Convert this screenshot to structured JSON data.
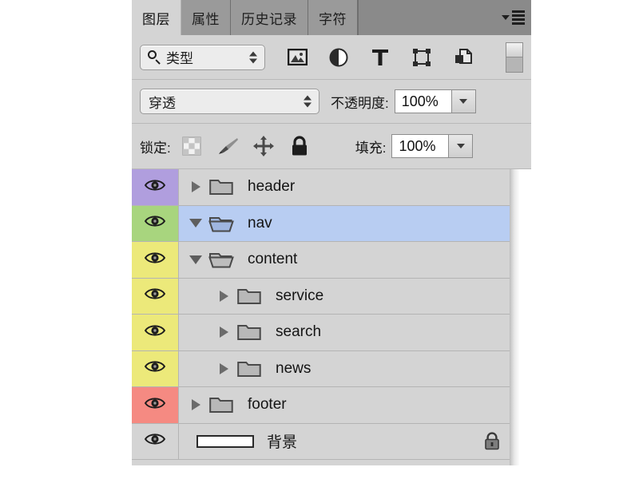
{
  "panel": {
    "tabs": [
      {
        "label": "图层",
        "active": true
      },
      {
        "label": "属性",
        "active": false
      },
      {
        "label": "历史记录",
        "active": false
      },
      {
        "label": "字符",
        "active": false
      }
    ],
    "menu_icon": "panel-menu-icon"
  },
  "filter_row": {
    "search_icon": "search-icon",
    "filter_type": "类型",
    "icons": [
      {
        "name": "filter-pixel-layers-icon"
      },
      {
        "name": "filter-adjustment-layers-icon"
      },
      {
        "name": "filter-type-layers-icon"
      },
      {
        "name": "filter-shape-layers-icon"
      },
      {
        "name": "filter-smart-object-icon"
      }
    ],
    "toggle": "filter-enable-toggle"
  },
  "blend_row": {
    "blend_mode": "穿透",
    "opacity_label": "不透明度:",
    "opacity_value": "100%"
  },
  "lock_row": {
    "lock_label": "锁定:",
    "lock_icons": [
      {
        "name": "lock-transparent-pixels-icon"
      },
      {
        "name": "lock-image-pixels-icon"
      },
      {
        "name": "lock-position-icon"
      },
      {
        "name": "lock-all-icon"
      }
    ],
    "fill_label": "填充:",
    "fill_value": "100%"
  },
  "layers": [
    {
      "name": "header",
      "type": "group",
      "expanded": false,
      "indent": 0,
      "color": "#b09ede",
      "eye": "visible",
      "selected": false,
      "locked": false
    },
    {
      "name": "nav",
      "type": "group",
      "expanded": true,
      "indent": 0,
      "color": "#a8d57e",
      "eye": "visible",
      "selected": true,
      "locked": false
    },
    {
      "name": "content",
      "type": "group",
      "expanded": true,
      "indent": 0,
      "color": "#ece97a",
      "eye": "visible",
      "selected": false,
      "locked": false
    },
    {
      "name": "service",
      "type": "group",
      "expanded": false,
      "indent": 1,
      "color": "#ece97a",
      "eye": "visible",
      "selected": false,
      "locked": false
    },
    {
      "name": "search",
      "type": "group",
      "expanded": false,
      "indent": 1,
      "color": "#ece97a",
      "eye": "visible",
      "selected": false,
      "locked": false
    },
    {
      "name": "news",
      "type": "group",
      "expanded": false,
      "indent": 1,
      "color": "#ece97a",
      "eye": "visible",
      "selected": false,
      "locked": false
    },
    {
      "name": "footer",
      "type": "group",
      "expanded": false,
      "indent": 0,
      "color": "#f58a82",
      "eye": "visible",
      "selected": false,
      "locked": false
    },
    {
      "name": "背景",
      "type": "layer",
      "expanded": null,
      "indent": 0,
      "color": "#d4d4d4",
      "eye": "visible",
      "selected": false,
      "locked": true
    }
  ],
  "colors": {
    "panel_bg": "#d4d4d4",
    "tab_bar": "#8a8a8a",
    "selection": "#b8cdf2",
    "row_border": "#b4b4b4"
  }
}
